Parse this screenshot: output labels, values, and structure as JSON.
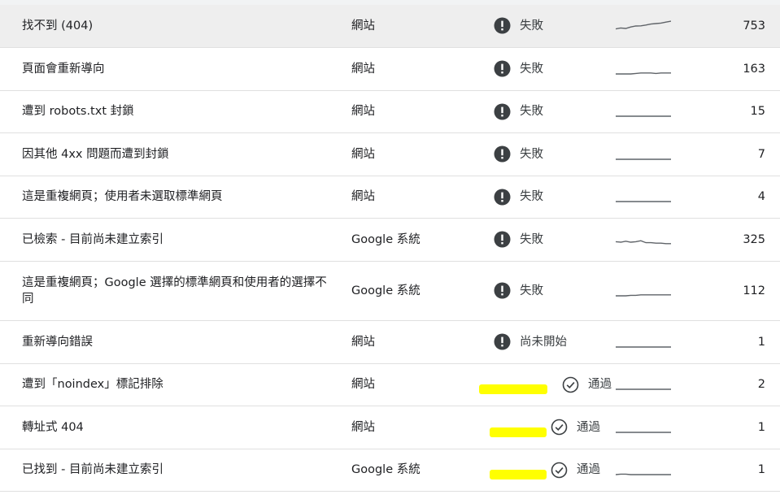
{
  "rows": [
    {
      "reason": "找不到 (404)",
      "source": "網站",
      "status": "失敗",
      "status_type": "fail",
      "count": "753",
      "trend": [
        2,
        3,
        2.5,
        4,
        5,
        5.2,
        6,
        7,
        7.5,
        8,
        9,
        10
      ]
    },
    {
      "reason": "頁面會重新導向",
      "source": "網站",
      "status": "失敗",
      "status_type": "fail",
      "count": "163",
      "trend": [
        0,
        0,
        0,
        0,
        0.5,
        1,
        1,
        1,
        0.5,
        1,
        1,
        1
      ]
    },
    {
      "reason": "遭到 robots.txt 封鎖",
      "source": "網站",
      "status": "失敗",
      "status_type": "fail",
      "count": "15",
      "trend": [
        0,
        0,
        0,
        0,
        0,
        0,
        0,
        0,
        0,
        0,
        0,
        0
      ]
    },
    {
      "reason": "因其他 4xx 問題而遭到封鎖",
      "source": "網站",
      "status": "失敗",
      "status_type": "fail",
      "count": "7",
      "trend": [
        0,
        0,
        0,
        0,
        0,
        0,
        0,
        0,
        0,
        0,
        0,
        0
      ]
    },
    {
      "reason": "這是重複網頁；使用者未選取標準網頁",
      "source": "網站",
      "status": "失敗",
      "status_type": "fail",
      "count": "4",
      "trend": [
        0,
        0,
        0,
        0,
        0,
        0,
        0,
        0,
        0,
        0,
        0,
        0
      ]
    },
    {
      "reason": "已檢索 - 目前尚未建立索引",
      "source": "Google 系統",
      "status": "失敗",
      "status_type": "fail",
      "count": "325",
      "trend": [
        3,
        2.5,
        3.5,
        2.5,
        3,
        4,
        2,
        2,
        1.5,
        1.5,
        1,
        1
      ]
    },
    {
      "reason": "這是重複網頁；Google 選擇的標準網頁和使用者的選擇不同",
      "source": "Google 系統",
      "status": "失敗",
      "status_type": "fail",
      "count": "112",
      "trend": [
        0,
        0,
        0,
        0.5,
        0.5,
        1,
        1,
        1,
        1,
        1,
        1,
        1
      ]
    },
    {
      "reason": "重新導向錯誤",
      "source": "網站",
      "status": "尚未開始",
      "status_type": "pending",
      "count": "1",
      "trend": [
        0,
        0,
        0,
        0,
        0,
        0,
        0,
        0,
        0,
        0,
        0,
        0
      ]
    },
    {
      "reason": "遭到「noindex」標記排除",
      "source": "網站",
      "status": "通過",
      "status_type": "pass",
      "count": "2",
      "trend": [
        0,
        0,
        0,
        0,
        0,
        0,
        0,
        0,
        0,
        0,
        0,
        0
      ]
    },
    {
      "reason": "轉址式 404",
      "source": "網站",
      "status": "通過",
      "status_type": "pass",
      "count": "1",
      "trend": [
        0,
        0,
        0,
        0,
        0,
        0,
        0,
        0,
        0,
        0,
        0,
        0
      ]
    },
    {
      "reason": "已找到 - 目前尚未建立索引",
      "source": "Google 系統",
      "status": "通過",
      "status_type": "pass",
      "count": "1",
      "trend": [
        0,
        0.5,
        0.5,
        0,
        0,
        0,
        0,
        0,
        0,
        0,
        0,
        0
      ]
    }
  ],
  "colors": {
    "fail_icon": "#3c4043",
    "pending_icon": "#3c4043",
    "pass_icon": "#3c4043",
    "highlight": "#ffff00",
    "sparkline": "#5f6368"
  }
}
